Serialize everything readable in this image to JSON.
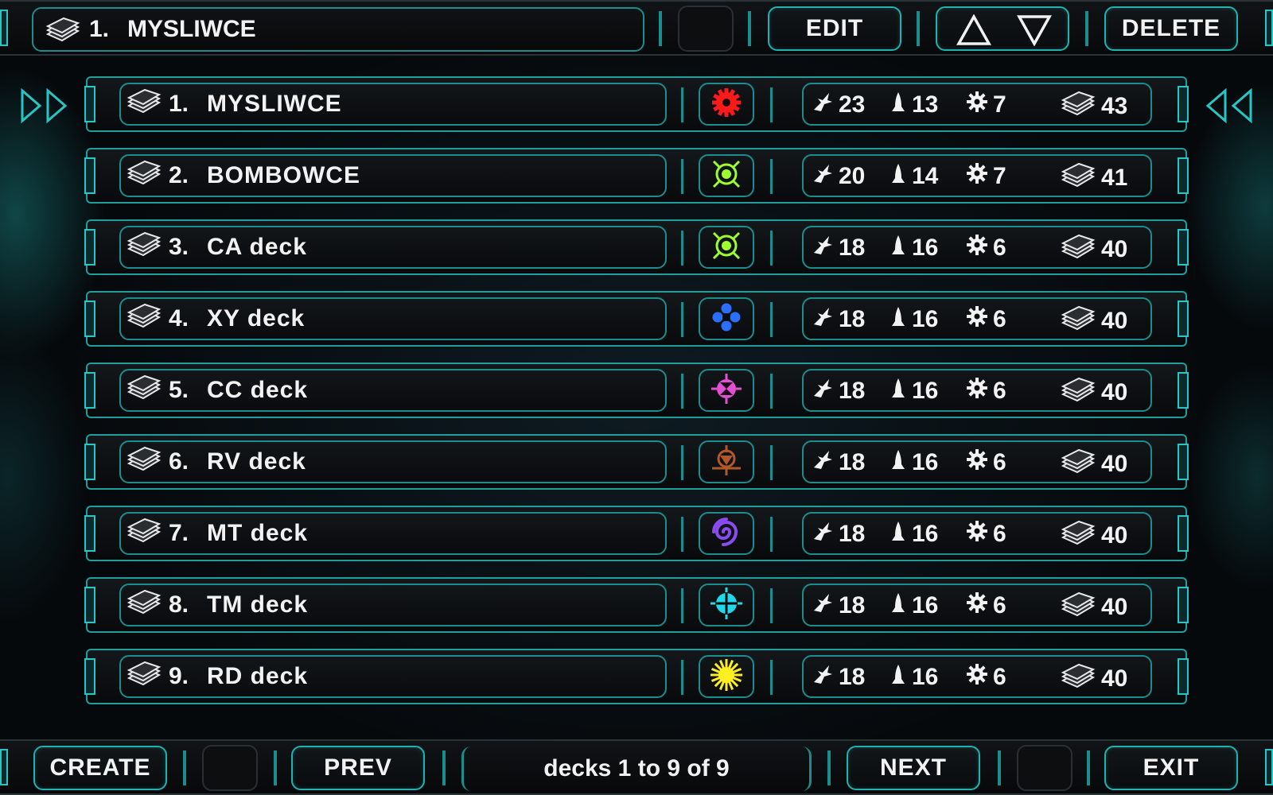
{
  "header": {
    "selected_number": "1.",
    "selected_name": "MYSLIWCE",
    "edit_label": "EDIT",
    "delete_label": "DELETE",
    "move_up_icon": "triangle-up-icon",
    "move_down_icon": "triangle-down-icon"
  },
  "decks": [
    {
      "number": "1.",
      "name": "MYSLIWCE",
      "faction_icon": "red-gear-icon",
      "faction_color": "#ff1a1a",
      "ships": "23",
      "units": "13",
      "gears": "7",
      "cards": "43",
      "selected": true
    },
    {
      "number": "2.",
      "name": "BOMBOWCE",
      "faction_icon": "green-target-icon",
      "faction_color": "#9cff2b",
      "ships": "20",
      "units": "14",
      "gears": "7",
      "cards": "41",
      "selected": false
    },
    {
      "number": "3.",
      "name": "CA deck",
      "faction_icon": "green-target-icon",
      "faction_color": "#9cff2b",
      "ships": "18",
      "units": "16",
      "gears": "6",
      "cards": "40",
      "selected": false
    },
    {
      "number": "4.",
      "name": "XY deck",
      "faction_icon": "blue-quad-circle-icon",
      "faction_color": "#2a6fff",
      "ships": "18",
      "units": "16",
      "gears": "6",
      "cards": "40",
      "selected": false
    },
    {
      "number": "5.",
      "name": "CC deck",
      "faction_icon": "pink-hourglass-icon",
      "faction_color": "#e050d0",
      "ships": "18",
      "units": "16",
      "gears": "6",
      "cards": "40",
      "selected": false
    },
    {
      "number": "6.",
      "name": "RV deck",
      "faction_icon": "brown-compass-icon",
      "faction_color": "#b0582a",
      "ships": "18",
      "units": "16",
      "gears": "6",
      "cards": "40",
      "selected": false
    },
    {
      "number": "7.",
      "name": "MT deck",
      "faction_icon": "purple-swirl-icon",
      "faction_color": "#8a4cf0",
      "ships": "18",
      "units": "16",
      "gears": "6",
      "cards": "40",
      "selected": false
    },
    {
      "number": "8.",
      "name": "TM deck",
      "faction_icon": "cyan-crosshair-icon",
      "faction_color": "#1fd8e8",
      "ships": "18",
      "units": "16",
      "gears": "6",
      "cards": "40",
      "selected": false
    },
    {
      "number": "9.",
      "name": "RD deck",
      "faction_icon": "yellow-sun-icon",
      "faction_color": "#ffee20",
      "ships": "18",
      "units": "16",
      "gears": "6",
      "cards": "40",
      "selected": false
    }
  ],
  "footer": {
    "create_label": "CREATE",
    "prev_label": "PREV",
    "page_info": "decks 1 to 9 of 9",
    "next_label": "NEXT",
    "exit_label": "EXIT"
  },
  "colors": {
    "accent": "#1fb2b2",
    "background": "#070a0d",
    "text": "#f2f2f2"
  }
}
